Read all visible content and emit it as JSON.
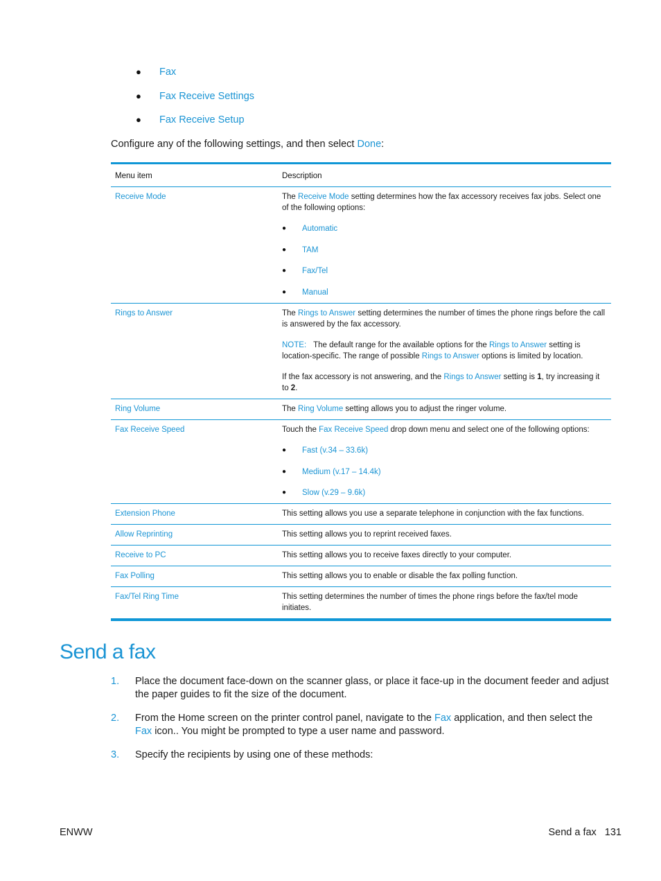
{
  "top_bullets": [
    "Fax",
    "Fax Receive Settings",
    "Fax Receive Setup"
  ],
  "intro": {
    "text_before": "Configure any of the following settings, and then select ",
    "link": "Done",
    "text_after": ":"
  },
  "table": {
    "headers": [
      "Menu item",
      "Description"
    ],
    "rows": [
      {
        "item": "Receive Mode",
        "desc_pre": "The ",
        "desc_link": "Receive Mode",
        "desc_post": " setting determines how the fax accessory receives fax jobs. Select one of the following options:",
        "options": [
          "Automatic",
          "TAM",
          "Fax/Tel",
          "Manual"
        ]
      },
      {
        "item": "Rings to Answer",
        "p1_pre": "The ",
        "p1_link": "Rings to Answer",
        "p1_post": " setting determines the number of times the phone rings before the call is answered by the fax accessory.",
        "note_label": "NOTE:",
        "note_pre": "The default range for the available options for the ",
        "note_link1": "Rings to Answer",
        "note_mid": " setting is location-specific. The range of possible ",
        "note_link2": "Rings to Answer",
        "note_post": " options is limited by location.",
        "p3_pre": "If the fax accessory is not answering, and the ",
        "p3_link": "Rings to Answer",
        "p3_mid": " setting is ",
        "p3_val1": "1",
        "p3_mid2": ", try increasing it to ",
        "p3_val2": "2",
        "p3_post": "."
      },
      {
        "item": "Ring Volume",
        "desc_pre": "The ",
        "desc_link": "Ring Volume",
        "desc_post": " setting allows you to adjust the ringer volume."
      },
      {
        "item": "Fax Receive Speed",
        "desc_pre": "Touch the ",
        "desc_link": "Fax Receive Speed",
        "desc_post": " drop down menu and select one of the following options:",
        "options": [
          "Fast (v.34 – 33.6k)",
          "Medium (v.17 – 14.4k)",
          "Slow (v.29 – 9.6k)"
        ]
      },
      {
        "item": "Extension Phone",
        "desc": "This setting allows you use a separate telephone in conjunction with the fax functions."
      },
      {
        "item": "Allow Reprinting",
        "desc": "This setting allows you to reprint received faxes."
      },
      {
        "item": "Receive to PC",
        "desc": "This setting allows you to receive faxes directly to your computer."
      },
      {
        "item": "Fax Polling",
        "desc": "This setting allows you to enable or disable the fax polling function."
      },
      {
        "item": "Fax/Tel Ring Time",
        "desc": "This setting determines the number of times the phone rings before the fax/tel mode initiates."
      }
    ]
  },
  "section": {
    "title": "Send a fax",
    "steps": [
      {
        "num": "1.",
        "text": "Place the document face-down on the scanner glass, or place it face-up in the document feeder and adjust the paper guides to fit the size of the document."
      },
      {
        "num": "2.",
        "pre": "From the Home screen on the printer control panel, navigate to the ",
        "link1": "Fax",
        "mid": " application, and then select the ",
        "link2": "Fax",
        "post": " icon.. You might be prompted to type a user name and password."
      },
      {
        "num": "3.",
        "text": "Specify the recipients by using one of these methods:"
      }
    ]
  },
  "footer": {
    "left": "ENWW",
    "right_label": "Send a fax",
    "page": "131"
  },
  "colors": {
    "accent": "#1a94d4",
    "rule": "#0f96d6"
  }
}
